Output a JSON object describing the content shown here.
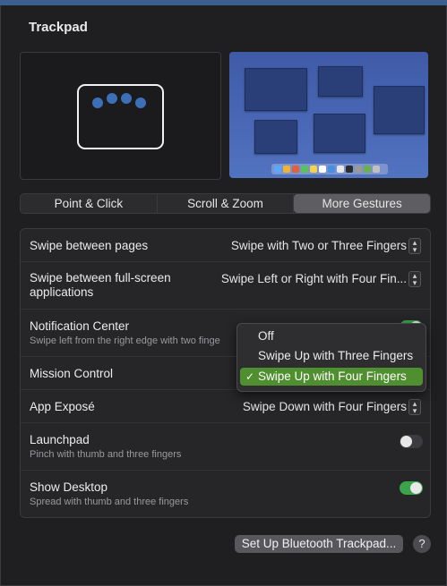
{
  "window": {
    "title": "Trackpad"
  },
  "tabs": [
    {
      "label": "Point & Click",
      "active": false
    },
    {
      "label": "Scroll & Zoom",
      "active": false
    },
    {
      "label": "More Gestures",
      "active": true
    }
  ],
  "settings": [
    {
      "label": "Swipe between pages",
      "value": "Swipe with Two or Three Fingers",
      "control": "popup"
    },
    {
      "label": "Swipe between full-screen applications",
      "value": "Swipe Left or Right with Four Fin...",
      "control": "popup"
    },
    {
      "label": "Notification Center",
      "subtitle": "Swipe left from the right edge with two finge",
      "control": "toggle",
      "on": true
    },
    {
      "label": "Mission Control",
      "control": "popup-open"
    },
    {
      "label": "App Exposé",
      "value": "Swipe Down with Four Fingers",
      "control": "popup"
    },
    {
      "label": "Launchpad",
      "subtitle": "Pinch with thumb and three fingers",
      "control": "toggle",
      "on": false
    },
    {
      "label": "Show Desktop",
      "subtitle": "Spread with thumb and three fingers",
      "control": "toggle",
      "on": true
    }
  ],
  "dropdown": {
    "options": [
      "Off",
      "Swipe Up with Three Fingers",
      "Swipe Up with Four Fingers"
    ],
    "selected": "Swipe Up with Four Fingers",
    "check_glyph": "✓"
  },
  "footer": {
    "bluetooth_button": "Set Up Bluetooth Trackpad...",
    "help_label": "?"
  },
  "icons": {
    "stepper": "up-down-chevron-icon",
    "help": "question-icon"
  },
  "colors": {
    "accent_green": "#3ba44a",
    "selection_green": "#4f8f2f",
    "trackpad_dot": "#3c6fb6"
  }
}
